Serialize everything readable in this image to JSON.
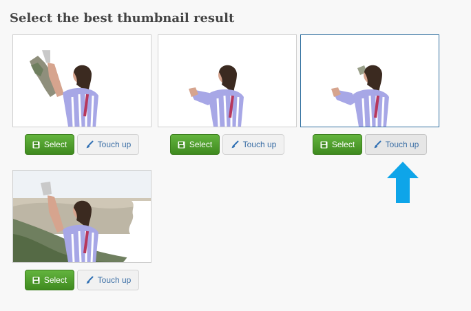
{
  "page": {
    "title": "Select the best thumbnail result"
  },
  "results": [
    {
      "select_label": "Select",
      "touchup_label": "Touch up"
    },
    {
      "select_label": "Select",
      "touchup_label": "Touch up"
    },
    {
      "select_label": "Select",
      "touchup_label": "Touch up",
      "highlighted": true
    },
    {
      "select_label": "Select",
      "touchup_label": "Touch up"
    }
  ],
  "icons": {
    "select": "floppy-disk-icon",
    "touchup": "paintbrush-icon",
    "indicator": "up-arrow-icon"
  },
  "colors": {
    "select_button": "#4f9f2c",
    "touchup_text": "#3a6ea5",
    "arrow": "#0ea5e9",
    "selected_border": "#2f6f9f"
  }
}
